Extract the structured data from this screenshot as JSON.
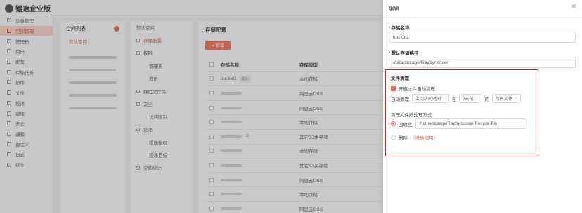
{
  "app": {
    "logo_text": "镭速企业版"
  },
  "sidebar": {
    "items": [
      {
        "label": "设备管理",
        "icon": "device-icon",
        "active": false
      },
      {
        "label": "空间管理",
        "icon": "space-icon",
        "active": true
      },
      {
        "label": "管理员",
        "icon": "admin-icon",
        "active": false
      },
      {
        "label": "用户",
        "icon": "user-icon",
        "active": false
      },
      {
        "label": "配置",
        "icon": "config-icon",
        "active": false
      },
      {
        "label": "传输任务",
        "icon": "transfer-icon",
        "active": false
      },
      {
        "label": "协作",
        "icon": "collab-icon",
        "active": false
      },
      {
        "label": "文件",
        "icon": "file-icon",
        "active": false
      },
      {
        "label": "投递",
        "icon": "send-icon",
        "active": false
      },
      {
        "label": "审核",
        "icon": "audit-icon",
        "active": false
      },
      {
        "label": "安全",
        "icon": "security-icon",
        "active": false
      },
      {
        "label": "通知",
        "icon": "bell-icon",
        "active": false
      },
      {
        "label": "自定义",
        "icon": "custom-icon",
        "active": false
      },
      {
        "label": "日志",
        "icon": "log-icon",
        "active": false
      },
      {
        "label": "统计",
        "icon": "stats-icon",
        "active": false
      }
    ]
  },
  "space_list": {
    "title": "空间列表",
    "first_item": "默认空间"
  },
  "space_nav": {
    "items": [
      {
        "label": "默认空间",
        "sub": false,
        "active": false
      },
      {
        "label": "存储配置",
        "sub": false,
        "active": true
      },
      {
        "label": "权限",
        "sub": false,
        "active": false
      },
      {
        "label": "管理员",
        "sub": true,
        "active": false
      },
      {
        "label": "成员",
        "sub": true,
        "active": false
      },
      {
        "label": "群组文件库",
        "sub": false,
        "active": false
      },
      {
        "label": "安全",
        "sub": false,
        "active": false
      },
      {
        "label": "访问限制",
        "sub": true,
        "active": false
      },
      {
        "label": "投递",
        "sub": false,
        "active": false
      },
      {
        "label": "投递授权",
        "sub": true,
        "active": false
      },
      {
        "label": "投递目标",
        "sub": true,
        "active": false
      },
      {
        "label": "空间统计",
        "sub": false,
        "active": false
      }
    ]
  },
  "storage": {
    "title": "存储配置",
    "new_button": "+ 新增",
    "columns": [
      "存储名称",
      "存储类型"
    ],
    "rows": [
      {
        "name": "bucket1",
        "tag": "默认",
        "type": "本地存储"
      },
      {
        "name": "",
        "tag": "",
        "type": "阿里云OSS"
      },
      {
        "name": "",
        "tag": "",
        "type": "阿里云OSS"
      },
      {
        "name": "",
        "tag": "",
        "type": "本地存储"
      },
      {
        "name": "-2",
        "tag": "",
        "type": "其它S3类存储"
      },
      {
        "name": "",
        "tag": "",
        "type": "本地存储"
      },
      {
        "name": "",
        "tag": "",
        "type": "其它S3类存储"
      },
      {
        "name": "",
        "tag": "",
        "type": "阿里云OSS"
      },
      {
        "name": "",
        "tag": "",
        "type": "本地存储"
      },
      {
        "name": "",
        "tag": "",
        "type": "阿里云OSS"
      }
    ]
  },
  "drawer": {
    "title": "编辑",
    "storage_name_label": "存储名称",
    "storage_name_value": "bucket1",
    "default_path_label": "默认存储路径",
    "default_path_value": "/data/storage/RaySync/user",
    "cleanup": {
      "title": "文件清理",
      "enable_label": "开启文件自动清理",
      "rule_prefix": "自动清理",
      "time_field": "上次访问时间",
      "word_at": "在",
      "period": "7天前",
      "word_of": "的",
      "file_scope": "所有文件",
      "handling_title": "清理文件的处理方式",
      "recycle_label": "回收至",
      "recycle_path": "/home/storage/RaySync/user/Recycle Bin",
      "delete_label": "删除",
      "delete_warning": "（谨慎使用）"
    }
  },
  "colors": {
    "accent": "#e4644a",
    "highlight": "#d7242b"
  }
}
